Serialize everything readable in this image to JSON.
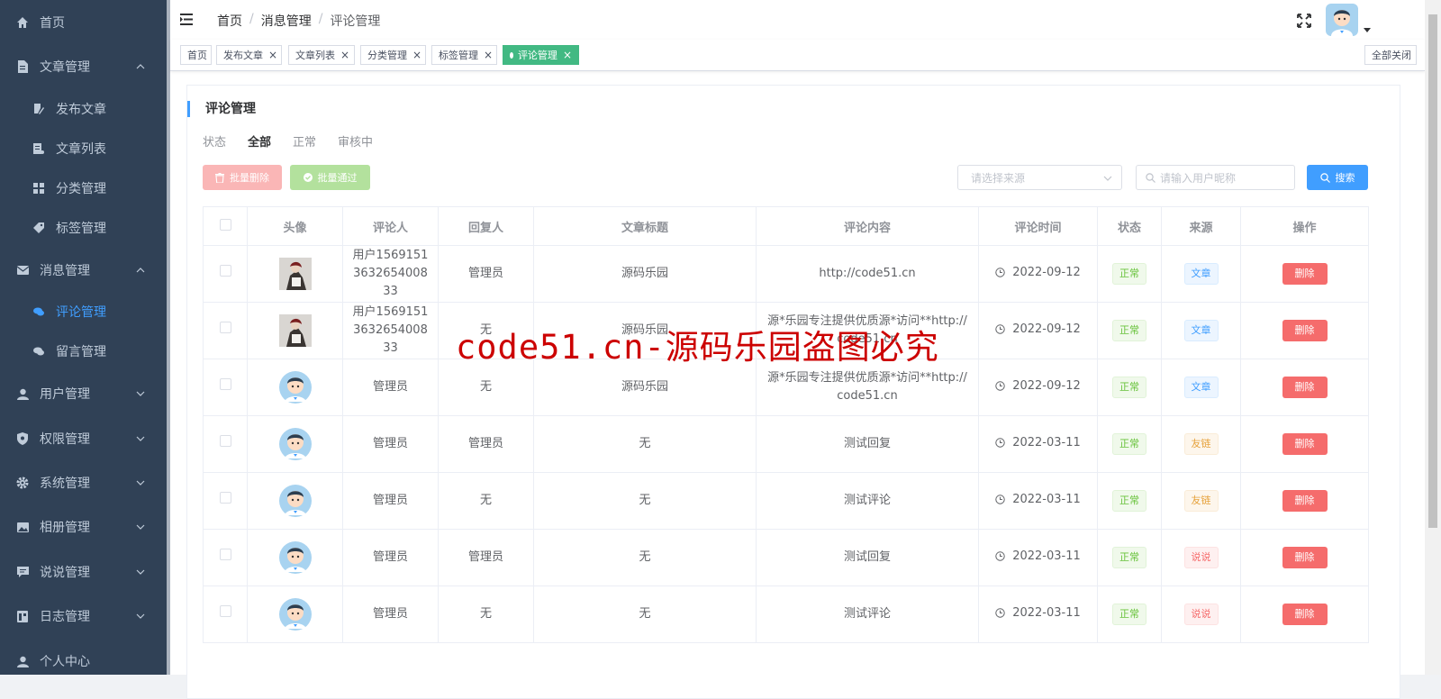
{
  "sidebar": {
    "items": [
      {
        "label": "首页",
        "icon": "home-icon"
      },
      {
        "label": "文章管理",
        "icon": "document-icon"
      },
      {
        "label": "发布文章",
        "icon": "edit-icon"
      },
      {
        "label": "文章列表",
        "icon": "list-icon"
      },
      {
        "label": "分类管理",
        "icon": "grid-icon"
      },
      {
        "label": "标签管理",
        "icon": "tag-icon"
      },
      {
        "label": "消息管理",
        "icon": "mail-icon"
      },
      {
        "label": "评论管理",
        "icon": "chat-icon"
      },
      {
        "label": "留言管理",
        "icon": "chat-icon"
      },
      {
        "label": "用户管理",
        "icon": "user-icon"
      },
      {
        "label": "权限管理",
        "icon": "shield-icon"
      },
      {
        "label": "系统管理",
        "icon": "gear-icon"
      },
      {
        "label": "相册管理",
        "icon": "image-icon"
      },
      {
        "label": "说说管理",
        "icon": "comment-icon"
      },
      {
        "label": "日志管理",
        "icon": "log-icon"
      },
      {
        "label": "个人中心",
        "icon": "person-icon"
      }
    ]
  },
  "breadcrumb": {
    "home": "首页",
    "parent": "消息管理",
    "current": "评论管理"
  },
  "tags": {
    "items": [
      "首页",
      "发布文章",
      "文章列表",
      "分类管理",
      "标签管理",
      "评论管理"
    ],
    "close_all": "全部关闭"
  },
  "page": {
    "title": "评论管理",
    "status_label": "状态",
    "status_all": "全部",
    "status_normal": "正常",
    "status_review": "审核中",
    "batch_delete": "批量删除",
    "batch_pass": "批量通过",
    "source_placeholder": "请选择来源",
    "search_placeholder": "请输入用户昵称",
    "search_button": "搜索"
  },
  "table": {
    "headers": [
      "头像",
      "评论人",
      "回复人",
      "文章标题",
      "评论内容",
      "评论时间",
      "状态",
      "来源",
      "操作"
    ],
    "rows": [
      {
        "commenter": "用户1569151363265400833",
        "reply": "管理员",
        "title": "源码乐园",
        "content": "http://code51.cn",
        "time": "2022-09-12",
        "status": "正常",
        "source": "文章",
        "action": "删除"
      },
      {
        "commenter": "用户1569151363265400833",
        "reply": "无",
        "title": "源码乐园",
        "content": "源*乐园专注提供优质源*访问**http://code51.cn",
        "time": "2022-09-12",
        "status": "正常",
        "source": "文章",
        "action": "删除"
      },
      {
        "commenter": "管理员",
        "reply": "无",
        "title": "源码乐园",
        "content": "源*乐园专注提供优质源*访问**http://code51.cn",
        "time": "2022-09-12",
        "status": "正常",
        "source": "文章",
        "action": "删除"
      },
      {
        "commenter": "管理员",
        "reply": "管理员",
        "title": "无",
        "content": "测试回复",
        "time": "2022-03-11",
        "status": "正常",
        "source": "友链",
        "action": "删除"
      },
      {
        "commenter": "管理员",
        "reply": "无",
        "title": "无",
        "content": "测试评论",
        "time": "2022-03-11",
        "status": "正常",
        "source": "友链",
        "action": "删除"
      },
      {
        "commenter": "管理员",
        "reply": "管理员",
        "title": "无",
        "content": "测试回复",
        "time": "2022-03-11",
        "status": "正常",
        "source": "说说",
        "action": "删除"
      },
      {
        "commenter": "管理员",
        "reply": "无",
        "title": "无",
        "content": "测试评论",
        "time": "2022-03-11",
        "status": "正常",
        "source": "说说",
        "action": "删除"
      }
    ]
  },
  "watermark": "code51.cn-源码乐园盗图必究",
  "colors": {
    "sidebar_bg": "#304156",
    "active": "#409eff",
    "tag_active": "#42b983",
    "danger": "#f56c6c",
    "success": "#67c23a"
  }
}
